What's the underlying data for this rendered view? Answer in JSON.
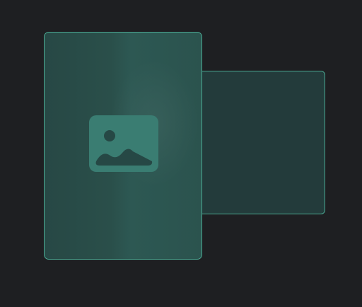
{
  "placeholder": {
    "icon": "image-placeholder-icon",
    "colors": {
      "background": "#1e1f22",
      "card_border": "#4aa892",
      "back_card_fill": "#233b3b",
      "front_card_fill": "#2a4f4a",
      "icon_fill": "#3a7d72",
      "icon_detail": "#264845"
    }
  }
}
